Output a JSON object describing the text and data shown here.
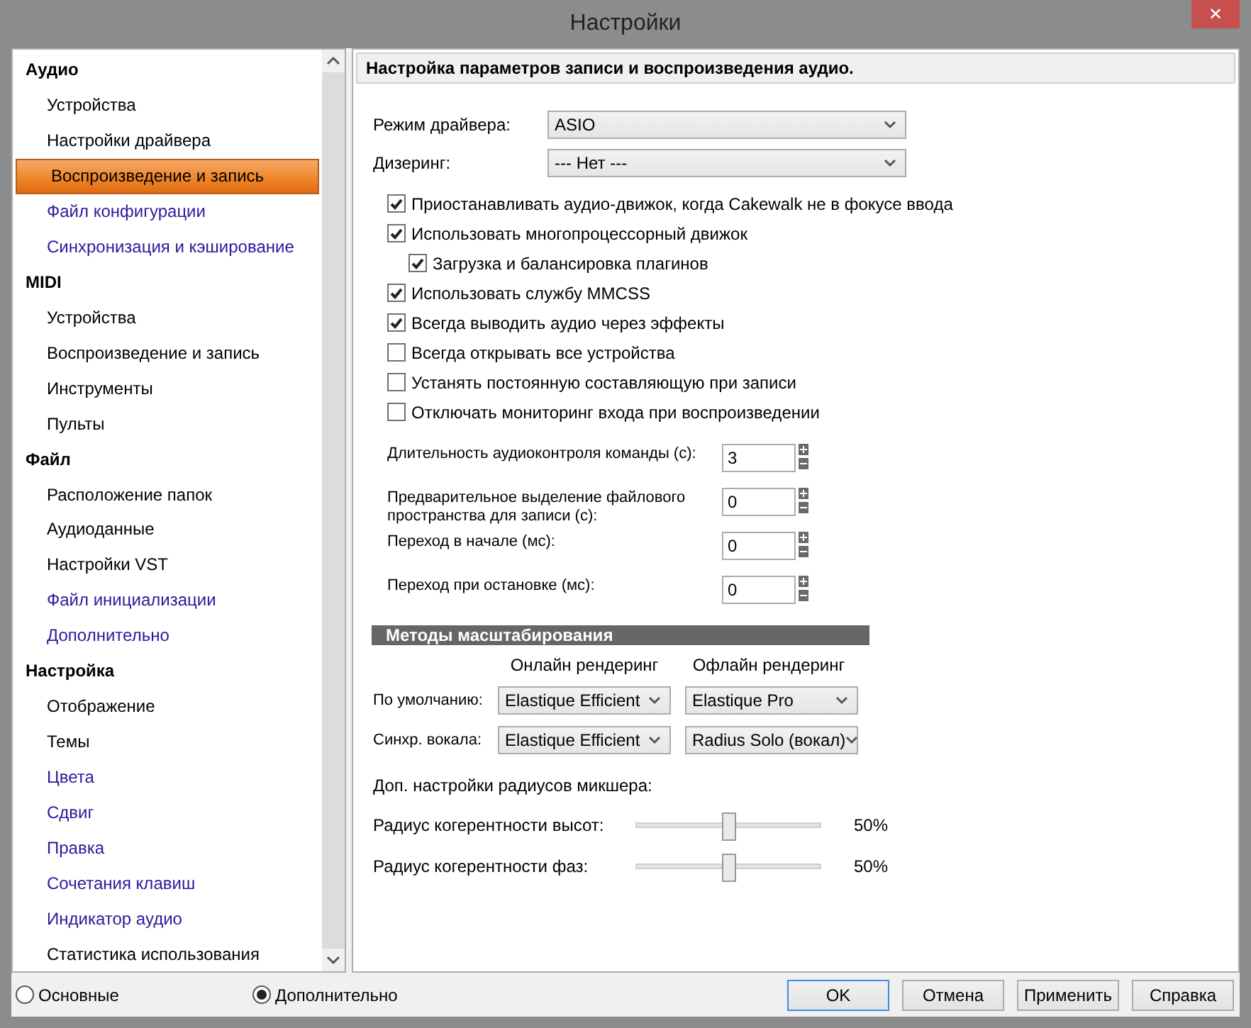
{
  "window": {
    "title": "Настройки",
    "close": "✕"
  },
  "sidebar": {
    "items": [
      {
        "label": "Аудио",
        "kind": "group",
        "selected": false
      },
      {
        "label": "Устройства",
        "kind": "page",
        "selected": false
      },
      {
        "label": "Настройки драйвера",
        "kind": "page",
        "selected": false
      },
      {
        "label": "Воспроизведение и запись",
        "kind": "page",
        "selected": true
      },
      {
        "label": "Файл конфигурации",
        "kind": "link",
        "selected": false
      },
      {
        "label": "Синхронизация и кэширование",
        "kind": "link",
        "selected": false
      },
      {
        "label": "MIDI",
        "kind": "group",
        "selected": false
      },
      {
        "label": "Устройства",
        "kind": "page",
        "selected": false
      },
      {
        "label": "Воспроизведение и запись",
        "kind": "page",
        "selected": false
      },
      {
        "label": "Инструменты",
        "kind": "page",
        "selected": false
      },
      {
        "label": "Пульты",
        "kind": "page",
        "selected": false
      },
      {
        "label": "Файл",
        "kind": "group",
        "selected": false
      },
      {
        "label": "Расположение папок",
        "kind": "page",
        "selected": false
      },
      {
        "label": "Аудиоданные",
        "kind": "page",
        "selected": false
      },
      {
        "label": "Настройки VST",
        "kind": "page",
        "selected": false
      },
      {
        "label": "Файл инициализации",
        "kind": "link",
        "selected": false
      },
      {
        "label": "Дополнительно",
        "kind": "link",
        "selected": false
      },
      {
        "label": "Настройка",
        "kind": "group",
        "selected": false
      },
      {
        "label": "Отображение",
        "kind": "page",
        "selected": false
      },
      {
        "label": "Темы",
        "kind": "page",
        "selected": false
      },
      {
        "label": "Цвета",
        "kind": "link",
        "selected": false
      },
      {
        "label": "Сдвиг",
        "kind": "link",
        "selected": false
      },
      {
        "label": "Правка",
        "kind": "link",
        "selected": false
      },
      {
        "label": "Сочетания клавиш",
        "kind": "link",
        "selected": false
      },
      {
        "label": "Индикатор аудио",
        "kind": "link",
        "selected": false
      },
      {
        "label": "Статистика использования",
        "kind": "page",
        "selected": false
      }
    ]
  },
  "mode": [
    {
      "label": "Основные",
      "selected": false
    },
    {
      "label": "Дополнительно",
      "selected": true
    }
  ],
  "header": "Настройка параметров записи и воспроизведения аудио.",
  "selects": [
    {
      "label": "Режим драйвера:",
      "value": "ASIO"
    },
    {
      "label": "Дизеринг:",
      "value": "--- Нет ---"
    }
  ],
  "checkboxes": [
    {
      "label": "Приостанавливать аудио-движок, когда Cakewalk не в фокусе ввода",
      "checked": true
    },
    {
      "label": "Использовать многопроцессорный движок",
      "checked": true,
      "children": [
        {
          "label": "Загрузка и балансировка плагинов",
          "checked": true
        }
      ]
    },
    {
      "label": "Использовать службу MMCSS",
      "checked": true
    },
    {
      "label": "Всегда выводить аудио через эффекты",
      "checked": true
    },
    {
      "label": "Всегда открывать все устройства",
      "checked": false
    },
    {
      "label": "Устанять постоянную составляющую при записи",
      "checked": false
    },
    {
      "label": "Отключать мониторинг входа при воспроизведении",
      "checked": false
    }
  ],
  "spinners": [
    {
      "label": "Длительность аудиоконтроля команды (с):",
      "value": "3"
    },
    {
      "label": "Предварительное выделение файлового пространства для записи (с):",
      "value": "0"
    },
    {
      "label": "Переход в начале (мс):",
      "value": "0"
    },
    {
      "label": "Переход при остановке (мс):",
      "value": "0"
    }
  ],
  "stretch": {
    "title": "Методы масштабирования",
    "columns": [
      "Онлайн рендеринг",
      "Офлайн рендеринг"
    ],
    "rows": [
      {
        "label": "По умолчанию:",
        "online": "Elastique Efficient",
        "offline": "Elastique Pro"
      },
      {
        "label": "Синхр. вокала:",
        "online": "Elastique Efficient",
        "offline": "Radius Solo (вокал)"
      }
    ]
  },
  "mixer": {
    "title": "Доп. настройки радиусов микшера:",
    "sliders": [
      {
        "label": "Радиус когерентности высот:",
        "level": 0.5,
        "reading": "50%"
      },
      {
        "label": "Радиус когерентности фаз:",
        "level": 0.5,
        "reading": "50%"
      }
    ]
  },
  "buttons": [
    {
      "label": "OK",
      "default": true
    },
    {
      "label": "Отмена",
      "default": false
    },
    {
      "label": "Применить",
      "default": false
    },
    {
      "label": "Справка",
      "default": false
    }
  ]
}
